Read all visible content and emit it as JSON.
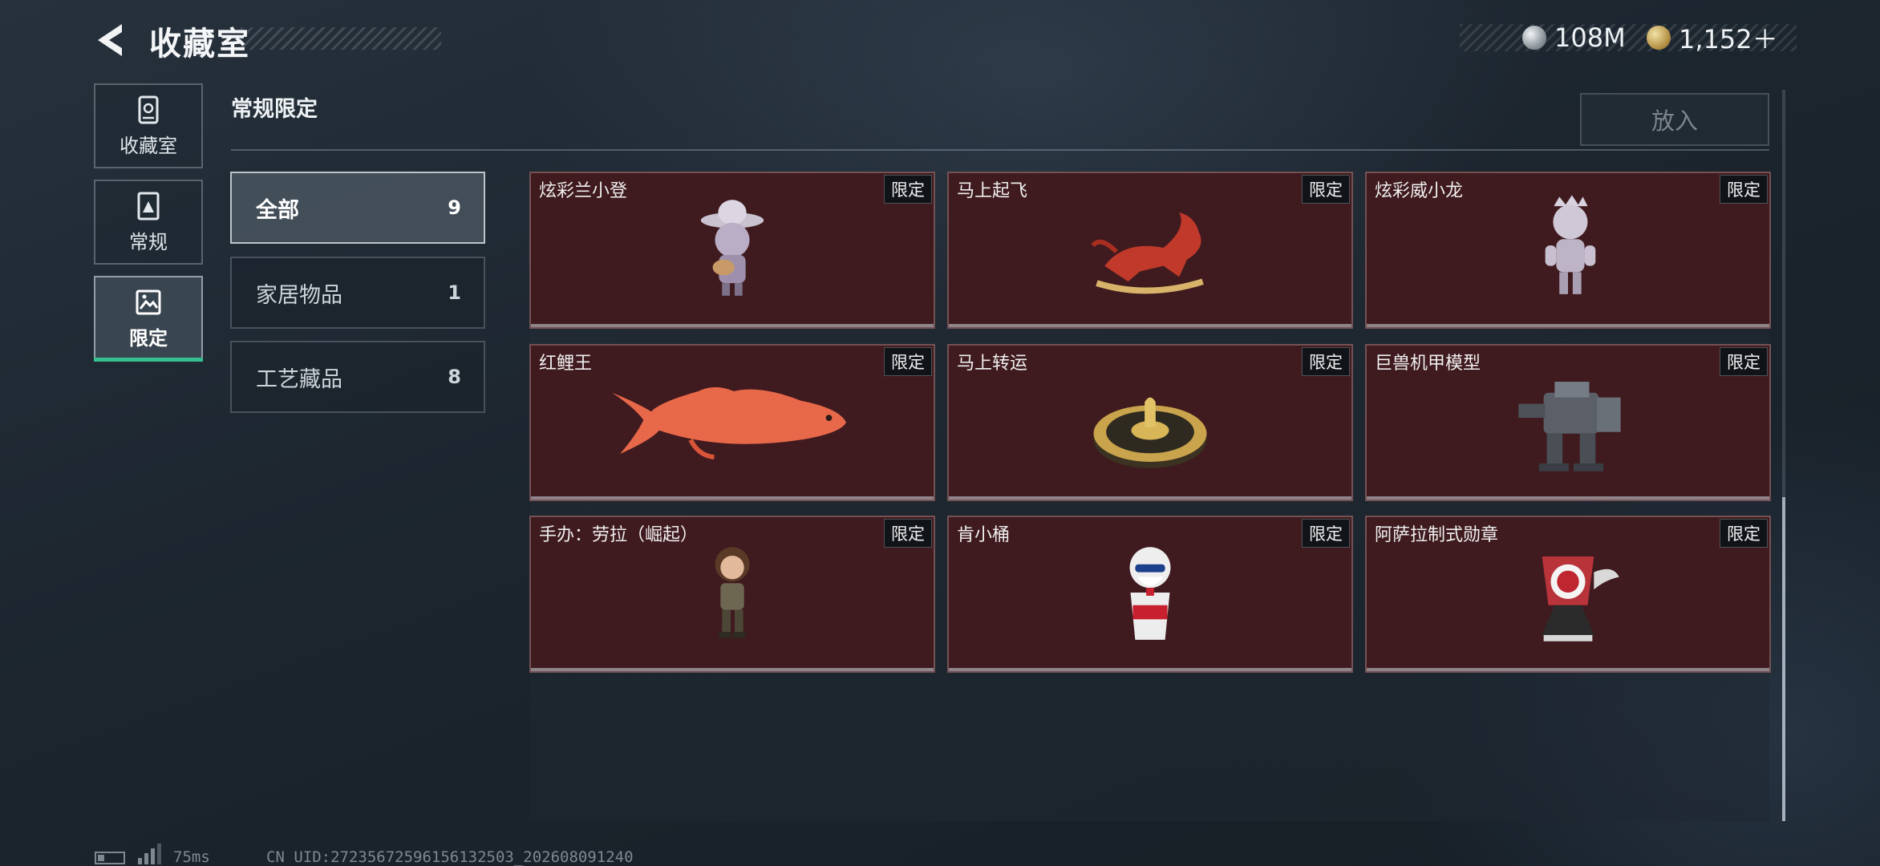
{
  "header": {
    "title": "收藏室",
    "currency": [
      {
        "icon": "silver-coin-icon",
        "value": "108M"
      },
      {
        "icon": "gold-coin-icon",
        "value": "1,152＋"
      }
    ]
  },
  "nav": [
    {
      "label": "收藏室",
      "icon": "vault-icon"
    },
    {
      "label": "常规",
      "icon": "card-icon"
    },
    {
      "label": "限定",
      "icon": "image-icon",
      "active": true
    }
  ],
  "section": {
    "title": "常规限定",
    "place_button": "放入"
  },
  "categories": [
    {
      "label": "全部",
      "count": "9",
      "selected": true
    },
    {
      "label": "家居物品",
      "count": "1"
    },
    {
      "label": "工艺藏品",
      "count": "8"
    }
  ],
  "items": [
    {
      "name": "炫彩兰小登",
      "tag": "限定",
      "icon": "figure-sombrero-icon"
    },
    {
      "name": "马上起飞",
      "tag": "限定",
      "icon": "rocking-horse-icon"
    },
    {
      "name": "炫彩威小龙",
      "tag": "限定",
      "icon": "figure-crown-icon"
    },
    {
      "name": "红鲤王",
      "tag": "限定",
      "icon": "carp-fish-icon"
    },
    {
      "name": "马上转运",
      "tag": "限定",
      "icon": "spinning-wheel-icon"
    },
    {
      "name": "巨兽机甲模型",
      "tag": "限定",
      "icon": "mech-model-icon"
    },
    {
      "name": "手办：劳拉（崛起）",
      "tag": "限定",
      "icon": "lara-figure-icon"
    },
    {
      "name": "肯小桶",
      "tag": "限定",
      "icon": "kfc-bucket-icon"
    },
    {
      "name": "阿萨拉制式勋章",
      "tag": "限定",
      "icon": "medal-icon"
    }
  ],
  "status": {
    "ping": "75ms",
    "uid": "CN UID:27235672596156132503_202608091240"
  },
  "colors": {
    "accent": "#35c08f",
    "card_bg": "#3f1a1e"
  }
}
